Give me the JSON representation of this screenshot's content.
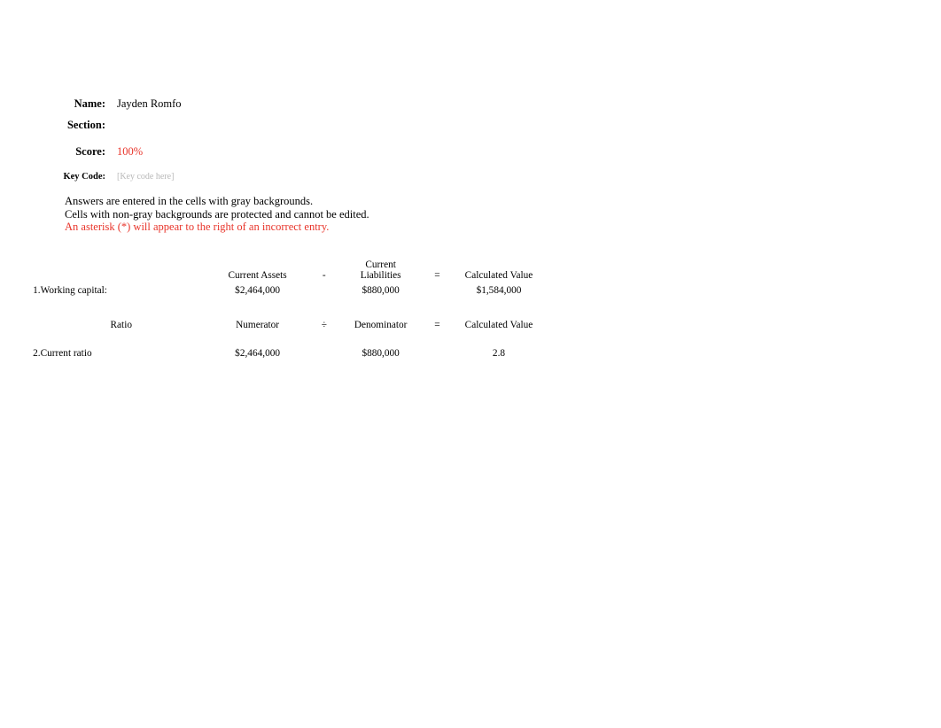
{
  "document": {
    "type": "accounting-worksheet",
    "background_color": "#ffffff",
    "accent_red": "#e8342a",
    "placeholder_gray": "#b8b8b8"
  },
  "header": {
    "name_label": "Name:",
    "name_value": "Jayden Romfo",
    "section_label": "Section:",
    "section_value": "",
    "score_label": "Score:",
    "score_value": "100%",
    "keycode_label": "Key Code:",
    "keycode_placeholder": "[Key code here]"
  },
  "instructions": {
    "line1": "Answers are entered in the cells with gray backgrounds.",
    "line2": "Cells with non-gray backgrounds are protected and cannot be edited.",
    "line3": "An asterisk (*) will appear to the right of an incorrect entry."
  },
  "table": {
    "section1": {
      "headers": {
        "number": "",
        "label": "",
        "operand1": "Current Assets",
        "operator": "-",
        "operand2_line1": "Current",
        "operand2_line2": "Liabilities",
        "equals": "=",
        "result": "Calculated Value"
      },
      "rows": [
        {
          "number": "1.",
          "label": "Working capital:",
          "operand1": "$2,464,000",
          "operand2": "$880,000",
          "result": "$1,584,000"
        }
      ]
    },
    "section2": {
      "headers": {
        "number": "",
        "label": "Ratio",
        "operand1": "Numerator",
        "operator": "÷",
        "operand2": "Denominator",
        "equals": "=",
        "result": "Calculated Value"
      },
      "rows": [
        {
          "number": "2.",
          "label": "Current ratio",
          "operand1": "$2,464,000",
          "operand2": "$880,000",
          "result": "2.8"
        }
      ]
    }
  }
}
